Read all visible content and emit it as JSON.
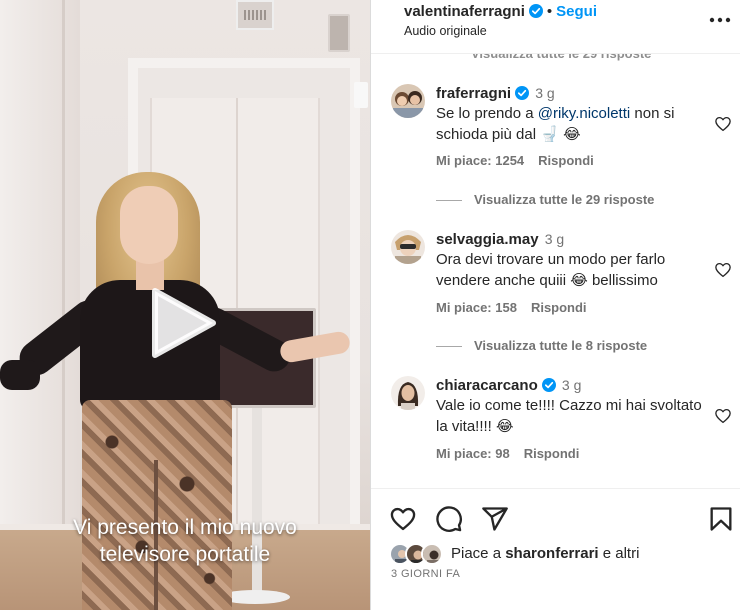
{
  "video": {
    "caption_line1": "Vi presento il mio nuovo",
    "caption_line2": "televisore portatile"
  },
  "header": {
    "username": "valentinaferragni",
    "separator": "•",
    "follow_label": "Segui",
    "audio": "Audio originale"
  },
  "partial_top": "Visualizza tutte le 29 risposte",
  "comments": [
    {
      "user": "fraferragni",
      "time": "3 g",
      "text_before": "Se lo prendo a ",
      "mention": "@riky.nicoletti",
      "text_after": " non si schioda più dal 🚽 😂",
      "likes": "Mi piace: 1254",
      "reply": "Rispondi",
      "view_replies": "Visualizza tutte le 29 risposte"
    },
    {
      "user": "selvaggia.may",
      "time": "3 g",
      "text": "Ora devi trovare un modo per farlo vendere anche quiii 😂  bellissimo",
      "likes": "Mi piace: 158",
      "reply": "Rispondi",
      "view_replies": "Visualizza tutte le 8 risposte"
    },
    {
      "user": "chiaracarcano",
      "time": "3 g",
      "text": "Vale io come te!!!! Cazzo mi hai svoltato la vita!!!! 😂",
      "likes": "Mi piace: 98",
      "reply": "Rispondi"
    }
  ],
  "footer": {
    "likes_prefix": "Piace a ",
    "likes_user": "sharonferrari",
    "likes_suffix": " e altri",
    "date": "3 GIORNI FA"
  },
  "colors": {
    "accent": "#0095f6",
    "verified": "#0095f6",
    "text_primary": "#262626",
    "text_secondary": "#737373"
  },
  "icons": [
    "verified-icon",
    "more-icon",
    "heart-icon",
    "comment-icon",
    "share-icon",
    "bookmark-icon",
    "play-icon"
  ]
}
